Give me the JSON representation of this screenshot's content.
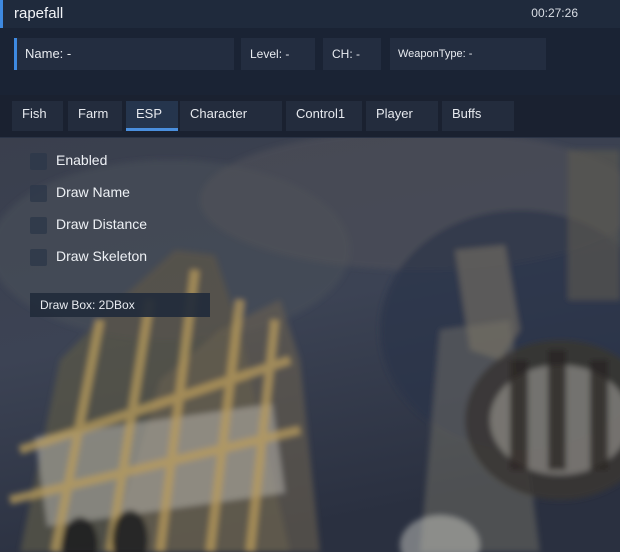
{
  "window": {
    "title": "rapefall",
    "clock": "00:27:26"
  },
  "info": {
    "name": "Name: -",
    "level": "Level: -",
    "ch": "CH: -",
    "weapon_type": "WeaponType: -"
  },
  "tabs": [
    {
      "label": "Fish",
      "active": false
    },
    {
      "label": "Farm",
      "active": false
    },
    {
      "label": "ESP",
      "active": true
    },
    {
      "label": "Character",
      "active": false
    },
    {
      "label": "Control1",
      "active": false
    },
    {
      "label": "Player",
      "active": false
    },
    {
      "label": "Buffs",
      "active": false
    }
  ],
  "esp": {
    "options": [
      {
        "label": "Enabled",
        "checked": false
      },
      {
        "label": "Draw Name",
        "checked": false
      },
      {
        "label": "Draw Distance",
        "checked": false
      },
      {
        "label": "Draw Skeleton",
        "checked": false
      }
    ],
    "draw_box": "Draw Box: 2DBox"
  },
  "colors": {
    "accent": "#3e89e0",
    "panel": "#1a2334",
    "field": "#232d40"
  }
}
